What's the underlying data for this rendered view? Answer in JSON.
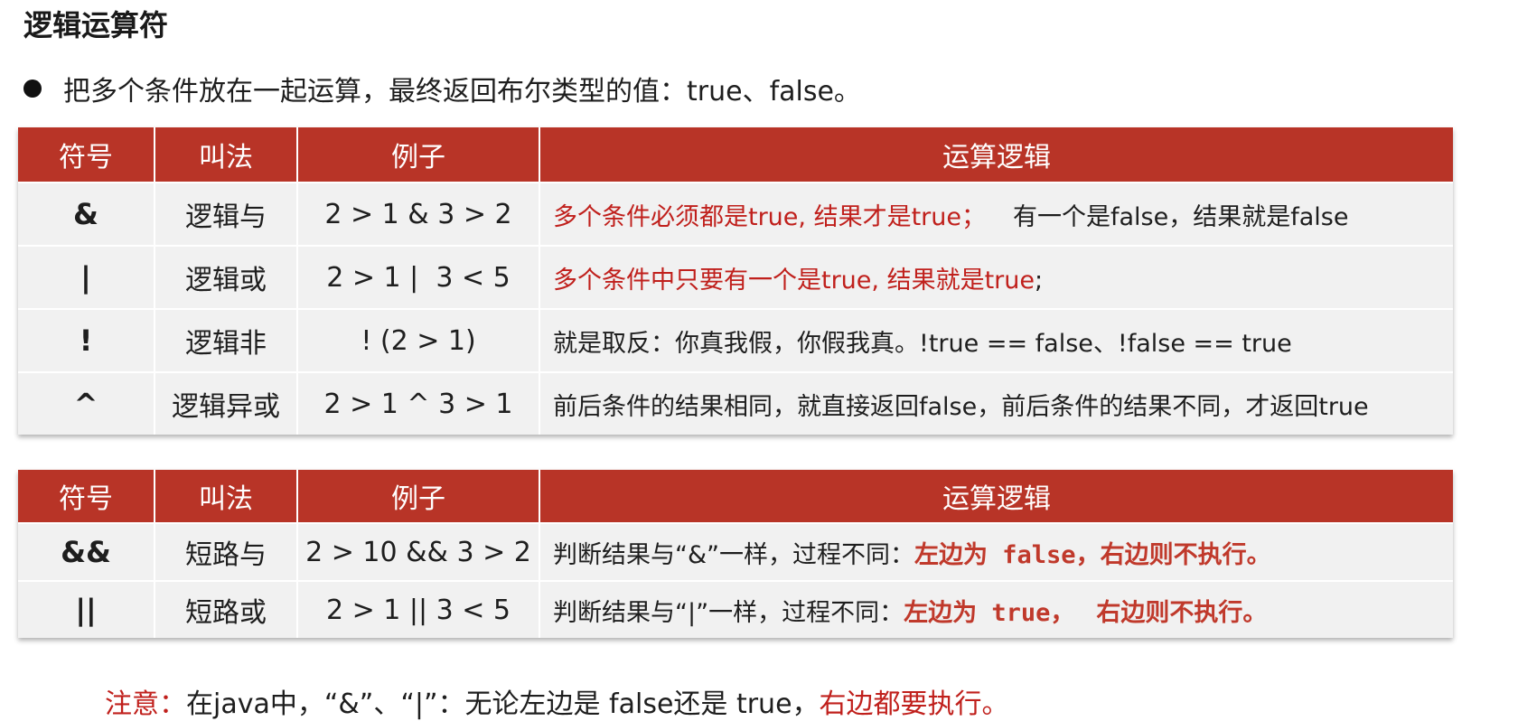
{
  "page": {
    "title": "逻辑运算符",
    "intro": "把多个条件放在一起运算，最终返回布尔类型的值：true、false。"
  },
  "colors": {
    "header_bg": "#b83427",
    "row_bg": "#f1f1f1",
    "highlight_red": "#c0201c"
  },
  "headers": {
    "symbol": "符号",
    "name": "叫法",
    "example": "例子",
    "logic": "运算逻辑"
  },
  "table1": {
    "rows": [
      {
        "symbol": "&",
        "name": "逻辑与",
        "example": "2 > 1 & 3 > 2",
        "logic_red": "多个条件必须都是true, 结果才是true；",
        "logic_plain": "有一个是false，结果就是false"
      },
      {
        "symbol": "|",
        "name": "逻辑或",
        "example": "2 > 1 |  3 < 5",
        "logic_red": "多个条件中只要有一个是true, 结果就是true",
        "logic_plain": ";"
      },
      {
        "symbol": "!",
        "name": "逻辑非",
        "example": "! (2 > 1)",
        "logic_plain": "就是取反：你真我假，你假我真。!true == false、!false == true"
      },
      {
        "symbol": "^",
        "name": "逻辑异或",
        "example": "2 > 1 ^ 3 > 1",
        "logic_plain": "前后条件的结果相同，就直接返回false，前后条件的结果不同，才返回true"
      }
    ]
  },
  "table2": {
    "rows": [
      {
        "symbol": "&&",
        "name": "短路与",
        "example": "2 > 10 && 3 > 2",
        "logic_plain": "判断结果与“&”一样，过程不同：",
        "logic_bold_a": "左边为",
        "logic_code": " false，",
        "logic_bold_b": "右边则不执行。"
      },
      {
        "symbol": "||",
        "name": "短路或",
        "example": "2 > 1 || 3 < 5",
        "logic_plain": "判断结果与“|”一样，过程不同：",
        "logic_bold_a": "左边为",
        "logic_code": " true，",
        "logic_bold_b": "右边则不执行。"
      }
    ]
  },
  "note": {
    "label": "注意：",
    "text": "在java中，“&”、“|”：无论左边是 false还是 true，",
    "emphasis": "右边都要执行。"
  }
}
